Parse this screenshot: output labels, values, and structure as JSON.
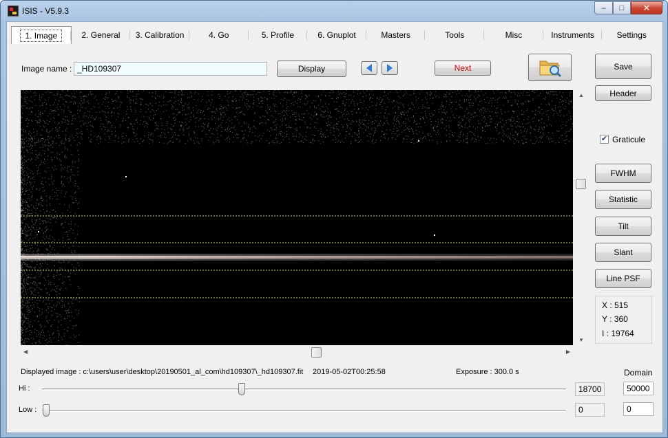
{
  "window": {
    "title": "ISIS - V5.9.3"
  },
  "tabs": [
    "1. Image",
    "2. General",
    "3. Calibration",
    "4. Go",
    "5. Profile",
    "6. Gnuplot",
    "Masters",
    "Tools",
    "Misc",
    "Instruments",
    "Settings"
  ],
  "active_tab": "1. Image",
  "image_name": {
    "label": "Image name :",
    "value": "_HD109307"
  },
  "buttons": {
    "display": "Display",
    "next": "Next",
    "save": "Save",
    "header": "Header",
    "fwhm": "FWHM",
    "statistic": "Statistic",
    "tilt": "Tilt",
    "slant": "Slant",
    "line_psf": "Line PSF"
  },
  "graticule": {
    "label": "Graticule",
    "checked": true
  },
  "cursor": {
    "x": "X : 515",
    "y": "Y : 360",
    "i": "I  : 19764"
  },
  "status": {
    "displayed_image": "Displayed image : c:\\users\\user\\desktop\\20190501_al_com\\hd109307\\_hd109307.fit",
    "datetime": "2019-05-02T00:25:58",
    "exposure": "Exposure : 300.0 s"
  },
  "levels": {
    "hi_label": "Hi :",
    "low_label": "Low :",
    "hi_value": "18700",
    "low_value": "0",
    "domain_label": "Domain",
    "domain_hi": "50000",
    "domain_low": "0",
    "hi_fraction": 0.374,
    "low_fraction": 0.0
  },
  "colors": {
    "graticule_line": "#c8e65a",
    "spectrum": "#ffffff",
    "next_text": "#cc0000",
    "nav_arrow": "#2f7bd6"
  },
  "icons": {
    "open_folder": "folder-search-icon"
  }
}
